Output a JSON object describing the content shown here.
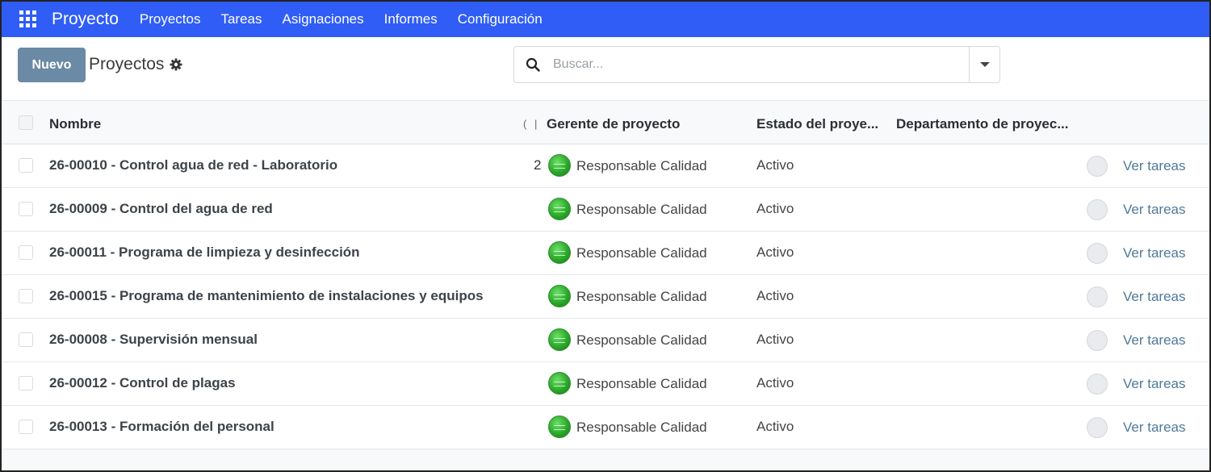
{
  "navbar": {
    "app_icon": "grid-apps-icon",
    "brand": "Proyecto",
    "menu": [
      "Proyectos",
      "Tareas",
      "Asignaciones",
      "Informes",
      "Configuración"
    ]
  },
  "control_panel": {
    "new_button": "Nuevo",
    "breadcrumb_title": "Proyectos",
    "settings_icon": "gear-icon",
    "search": {
      "placeholder": "Buscar...",
      "value": ""
    }
  },
  "table": {
    "headers": {
      "name": "Nombre",
      "separator": "( |",
      "manager": "Gerente de proyecto",
      "status": "Estado del proye...",
      "department": "Departamento de proyec..."
    },
    "rows": [
      {
        "name": "26-00010 - Control agua de red - Laboratorio",
        "count": "2",
        "manager": "Responsable Calidad",
        "status": "Activo",
        "action": "Ver tareas"
      },
      {
        "name": "26-00009 - Control del agua de red",
        "count": "",
        "manager": "Responsable Calidad",
        "status": "Activo",
        "action": "Ver tareas"
      },
      {
        "name": "26-00011 - Programa de limpieza y desinfección",
        "count": "",
        "manager": "Responsable Calidad",
        "status": "Activo",
        "action": "Ver tareas"
      },
      {
        "name": "26-00015 - Programa de mantenimiento de instalaciones y equipos",
        "count": "",
        "manager": "Responsable Calidad",
        "status": "Activo",
        "action": "Ver tareas"
      },
      {
        "name": "26-00008 - Supervisión mensual",
        "count": "",
        "manager": "Responsable Calidad",
        "status": "Activo",
        "action": "Ver tareas"
      },
      {
        "name": "26-00012 - Control de plagas",
        "count": "",
        "manager": "Responsable Calidad",
        "status": "Activo",
        "action": "Ver tareas"
      },
      {
        "name": "26-00013 - Formación del personal",
        "count": "",
        "manager": "Responsable Calidad",
        "status": "Activo",
        "action": "Ver tareas"
      }
    ]
  },
  "colors": {
    "navbar": "#2f5df5",
    "primary_button": "#6a8aa5",
    "link": "#4e7a99",
    "avatar": "#2aa82a"
  }
}
